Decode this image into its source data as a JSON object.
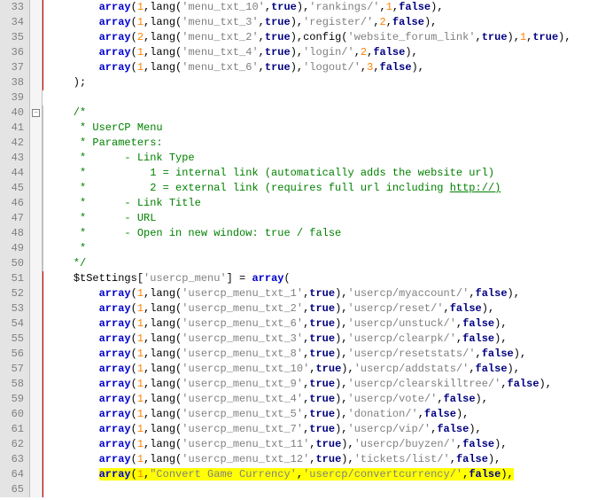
{
  "lines": [
    {
      "n": 33,
      "indent": "        ",
      "fn": "array",
      "args": [
        {
          "t": "num",
          "v": "1"
        },
        {
          "t": "call",
          "fn": "lang",
          "a": [
            {
              "t": "str",
              "v": "'menu_txt_10'"
            },
            {
              "t": "bool",
              "v": "true"
            }
          ]
        },
        {
          "t": "str",
          "v": "'rankings/'"
        },
        {
          "t": "num",
          "v": "1"
        },
        {
          "t": "bool",
          "v": "false"
        }
      ],
      "tail": ","
    },
    {
      "n": 34,
      "indent": "        ",
      "fn": "array",
      "args": [
        {
          "t": "num",
          "v": "1"
        },
        {
          "t": "call",
          "fn": "lang",
          "a": [
            {
              "t": "str",
              "v": "'menu_txt_3'"
            },
            {
              "t": "bool",
              "v": "true"
            }
          ]
        },
        {
          "t": "str",
          "v": "'register/'"
        },
        {
          "t": "num",
          "v": "2"
        },
        {
          "t": "bool",
          "v": "false"
        }
      ],
      "tail": ","
    },
    {
      "n": 35,
      "indent": "        ",
      "fn": "array",
      "args": [
        {
          "t": "num",
          "v": "2"
        },
        {
          "t": "call",
          "fn": "lang",
          "a": [
            {
              "t": "str",
              "v": "'menu_txt_2'"
            },
            {
              "t": "bool",
              "v": "true"
            }
          ]
        },
        {
          "t": "call",
          "fn": "config",
          "a": [
            {
              "t": "str",
              "v": "'website_forum_link'"
            },
            {
              "t": "bool",
              "v": "true"
            }
          ]
        },
        {
          "t": "num",
          "v": "1"
        },
        {
          "t": "bool",
          "v": "true"
        }
      ],
      "tail": ","
    },
    {
      "n": 36,
      "indent": "        ",
      "fn": "array",
      "args": [
        {
          "t": "num",
          "v": "1"
        },
        {
          "t": "call",
          "fn": "lang",
          "a": [
            {
              "t": "str",
              "v": "'menu_txt_4'"
            },
            {
              "t": "bool",
              "v": "true"
            }
          ]
        },
        {
          "t": "str",
          "v": "'login/'"
        },
        {
          "t": "num",
          "v": "2"
        },
        {
          "t": "bool",
          "v": "false"
        }
      ],
      "tail": ","
    },
    {
      "n": 37,
      "indent": "        ",
      "fn": "array",
      "args": [
        {
          "t": "num",
          "v": "1"
        },
        {
          "t": "call",
          "fn": "lang",
          "a": [
            {
              "t": "str",
              "v": "'menu_txt_6'"
            },
            {
              "t": "bool",
              "v": "true"
            }
          ]
        },
        {
          "t": "str",
          "v": "'logout/'"
        },
        {
          "t": "num",
          "v": "3"
        },
        {
          "t": "bool",
          "v": "false"
        }
      ],
      "tail": ","
    },
    {
      "n": 38,
      "raw": "    );"
    },
    {
      "n": 39,
      "raw": ""
    },
    {
      "n": 40,
      "fold": true,
      "cmt": "    /*"
    },
    {
      "n": 41,
      "cmt": "     * UserCP Menu"
    },
    {
      "n": 42,
      "cmt": "     * Parameters:"
    },
    {
      "n": 43,
      "cmt": "     *      - Link Type"
    },
    {
      "n": 44,
      "cmt": "     *          1 = internal link (automatically adds the website url)"
    },
    {
      "n": 45,
      "cmtlink": "     *          2 = external link (requires full url including ",
      "link": "http://)"
    },
    {
      "n": 46,
      "cmt": "     *      - Link Title"
    },
    {
      "n": 47,
      "cmt": "     *      - URL"
    },
    {
      "n": 48,
      "cmt": "     *      - Open in new window: true / false"
    },
    {
      "n": 49,
      "cmt": "     *"
    },
    {
      "n": 50,
      "cmt": "    */"
    },
    {
      "n": 51,
      "assign": true,
      "indent": "    ",
      "var": "$tSettings",
      "key": "'usercp_menu'",
      "fn": "array",
      "tail": "("
    },
    {
      "n": 52,
      "indent": "        ",
      "fn": "array",
      "args": [
        {
          "t": "num",
          "v": "1"
        },
        {
          "t": "call",
          "fn": "lang",
          "a": [
            {
              "t": "str",
              "v": "'usercp_menu_txt_1'"
            },
            {
              "t": "bool",
              "v": "true"
            }
          ]
        },
        {
          "t": "str",
          "v": "'usercp/myaccount/'"
        },
        {
          "t": "bool",
          "v": "false"
        }
      ],
      "tail": ","
    },
    {
      "n": 53,
      "indent": "        ",
      "fn": "array",
      "args": [
        {
          "t": "num",
          "v": "1"
        },
        {
          "t": "call",
          "fn": "lang",
          "a": [
            {
              "t": "str",
              "v": "'usercp_menu_txt_2'"
            },
            {
              "t": "bool",
              "v": "true"
            }
          ]
        },
        {
          "t": "str",
          "v": "'usercp/reset/'"
        },
        {
          "t": "bool",
          "v": "false"
        }
      ],
      "tail": ","
    },
    {
      "n": 54,
      "indent": "        ",
      "fn": "array",
      "args": [
        {
          "t": "num",
          "v": "1"
        },
        {
          "t": "call",
          "fn": "lang",
          "a": [
            {
              "t": "str",
              "v": "'usercp_menu_txt_6'"
            },
            {
              "t": "bool",
              "v": "true"
            }
          ]
        },
        {
          "t": "str",
          "v": "'usercp/unstuck/'"
        },
        {
          "t": "bool",
          "v": "false"
        }
      ],
      "tail": ","
    },
    {
      "n": 55,
      "indent": "        ",
      "fn": "array",
      "args": [
        {
          "t": "num",
          "v": "1"
        },
        {
          "t": "call",
          "fn": "lang",
          "a": [
            {
              "t": "str",
              "v": "'usercp_menu_txt_3'"
            },
            {
              "t": "bool",
              "v": "true"
            }
          ]
        },
        {
          "t": "str",
          "v": "'usercp/clearpk/'"
        },
        {
          "t": "bool",
          "v": "false"
        }
      ],
      "tail": ","
    },
    {
      "n": 56,
      "indent": "        ",
      "fn": "array",
      "args": [
        {
          "t": "num",
          "v": "1"
        },
        {
          "t": "call",
          "fn": "lang",
          "a": [
            {
              "t": "str",
              "v": "'usercp_menu_txt_8'"
            },
            {
              "t": "bool",
              "v": "true"
            }
          ]
        },
        {
          "t": "str",
          "v": "'usercp/resetstats/'"
        },
        {
          "t": "bool",
          "v": "false"
        }
      ],
      "tail": ","
    },
    {
      "n": 57,
      "indent": "        ",
      "fn": "array",
      "args": [
        {
          "t": "num",
          "v": "1"
        },
        {
          "t": "call",
          "fn": "lang",
          "a": [
            {
              "t": "str",
              "v": "'usercp_menu_txt_10'"
            },
            {
              "t": "bool",
              "v": "true"
            }
          ]
        },
        {
          "t": "str",
          "v": "'usercp/addstats/'"
        },
        {
          "t": "bool",
          "v": "false"
        }
      ],
      "tail": ","
    },
    {
      "n": 58,
      "indent": "        ",
      "fn": "array",
      "args": [
        {
          "t": "num",
          "v": "1"
        },
        {
          "t": "call",
          "fn": "lang",
          "a": [
            {
              "t": "str",
              "v": "'usercp_menu_txt_9'"
            },
            {
              "t": "bool",
              "v": "true"
            }
          ]
        },
        {
          "t": "str",
          "v": "'usercp/clearskilltree/'"
        },
        {
          "t": "bool",
          "v": "false"
        }
      ],
      "tail": ","
    },
    {
      "n": 59,
      "indent": "        ",
      "fn": "array",
      "args": [
        {
          "t": "num",
          "v": "1"
        },
        {
          "t": "call",
          "fn": "lang",
          "a": [
            {
              "t": "str",
              "v": "'usercp_menu_txt_4'"
            },
            {
              "t": "bool",
              "v": "true"
            }
          ]
        },
        {
          "t": "str",
          "v": "'usercp/vote/'"
        },
        {
          "t": "bool",
          "v": "false"
        }
      ],
      "tail": ","
    },
    {
      "n": 60,
      "indent": "        ",
      "fn": "array",
      "args": [
        {
          "t": "num",
          "v": "1"
        },
        {
          "t": "call",
          "fn": "lang",
          "a": [
            {
              "t": "str",
              "v": "'usercp_menu_txt_5'"
            },
            {
              "t": "bool",
              "v": "true"
            }
          ]
        },
        {
          "t": "str",
          "v": "'donation/'"
        },
        {
          "t": "bool",
          "v": "false"
        }
      ],
      "tail": ","
    },
    {
      "n": 61,
      "indent": "        ",
      "fn": "array",
      "args": [
        {
          "t": "num",
          "v": "1"
        },
        {
          "t": "call",
          "fn": "lang",
          "a": [
            {
              "t": "str",
              "v": "'usercp_menu_txt_7'"
            },
            {
              "t": "bool",
              "v": "true"
            }
          ]
        },
        {
          "t": "str",
          "v": "'usercp/vip/'"
        },
        {
          "t": "bool",
          "v": "false"
        }
      ],
      "tail": ","
    },
    {
      "n": 62,
      "indent": "        ",
      "fn": "array",
      "args": [
        {
          "t": "num",
          "v": "1"
        },
        {
          "t": "call",
          "fn": "lang",
          "a": [
            {
              "t": "str",
              "v": "'usercp_menu_txt_11'"
            },
            {
              "t": "bool",
              "v": "true"
            }
          ]
        },
        {
          "t": "str",
          "v": "'usercp/buyzen/'"
        },
        {
          "t": "bool",
          "v": "false"
        }
      ],
      "tail": ","
    },
    {
      "n": 63,
      "indent": "        ",
      "fn": "array",
      "args": [
        {
          "t": "num",
          "v": "1"
        },
        {
          "t": "call",
          "fn": "lang",
          "a": [
            {
              "t": "str",
              "v": "'usercp_menu_txt_12'"
            },
            {
              "t": "bool",
              "v": "true"
            }
          ]
        },
        {
          "t": "str",
          "v": "'tickets/list/'"
        },
        {
          "t": "bool",
          "v": "false"
        }
      ],
      "tail": ","
    },
    {
      "n": 64,
      "hl": true,
      "indent": "        ",
      "fn": "array",
      "args": [
        {
          "t": "num",
          "v": "1"
        },
        {
          "t": "str",
          "v": "\"Convert Game Currency'"
        },
        {
          "t": "str",
          "v": "'usercp/convertcurrency/'"
        },
        {
          "t": "bool",
          "v": "false"
        }
      ],
      "tail": ","
    },
    {
      "n": 65,
      "raw": ""
    }
  ]
}
